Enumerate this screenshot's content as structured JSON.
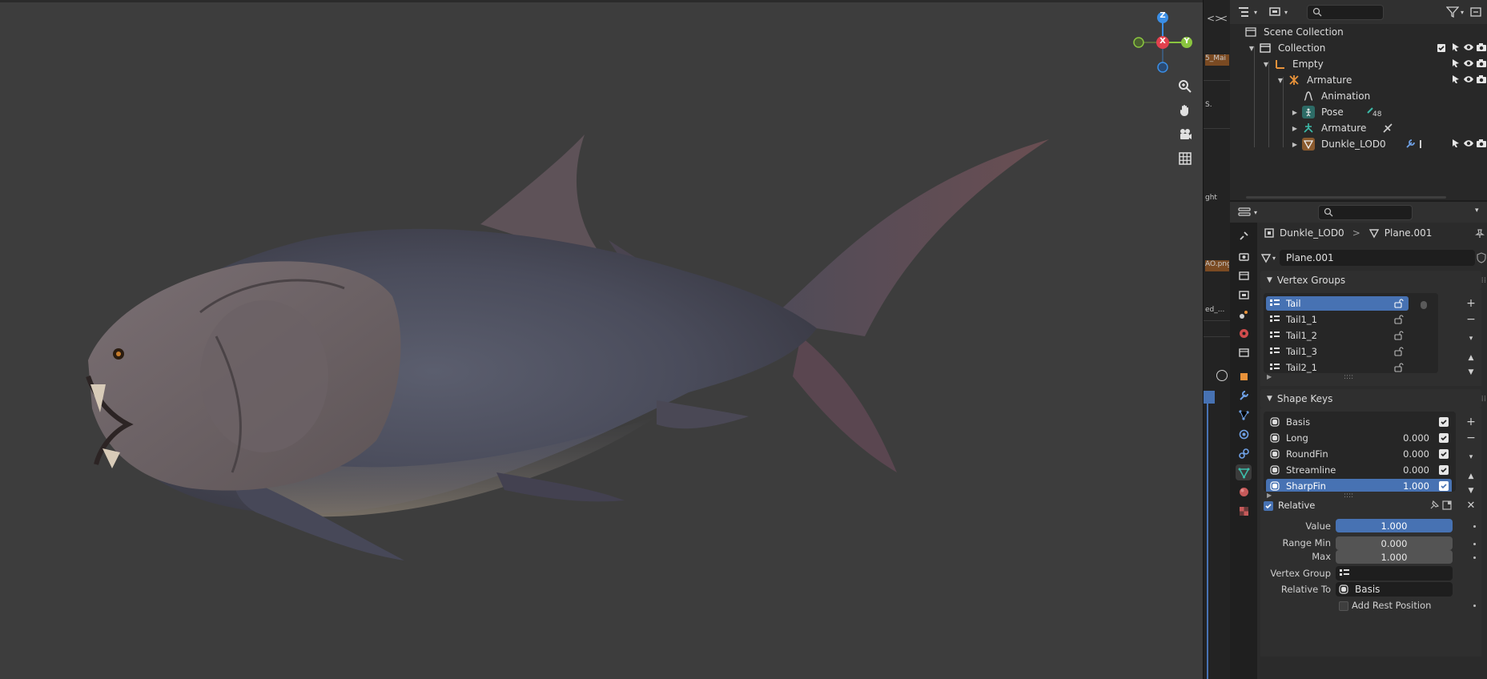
{
  "outliner": {
    "search_placeholder": "",
    "rows": [
      {
        "label": "Scene Collection"
      },
      {
        "label": "Collection"
      },
      {
        "label": "Empty"
      },
      {
        "label": "Armature"
      },
      {
        "label": "Animation"
      },
      {
        "label": "Pose",
        "badge": "48"
      },
      {
        "label": "Armature"
      },
      {
        "label": "Dunkle_LOD0"
      }
    ]
  },
  "middle_strip": {
    "chips": [
      "5_Mai",
      "S.",
      "ght",
      "AO.png",
      "ed_..."
    ]
  },
  "properties": {
    "breadcrumb": {
      "object": "Dunkle_LOD0",
      "separator": ">",
      "mesh": "Plane.001"
    },
    "data_name": "Plane.001",
    "vertex_groups": {
      "title": "Vertex Groups",
      "items": [
        {
          "label": "Tail",
          "selected": true
        },
        {
          "label": "Tail1_1",
          "selected": false
        },
        {
          "label": "Tail1_2",
          "selected": false
        },
        {
          "label": "Tail1_3",
          "selected": false
        },
        {
          "label": "Tail2_1",
          "selected": false
        }
      ]
    },
    "shape_keys": {
      "title": "Shape Keys",
      "items": [
        {
          "label": "Basis",
          "value": "",
          "selected": false
        },
        {
          "label": "Long",
          "value": "0.000",
          "selected": false
        },
        {
          "label": "RoundFin",
          "value": "0.000",
          "selected": false
        },
        {
          "label": "Streamline",
          "value": "0.000",
          "selected": false
        },
        {
          "label": "SharpFin",
          "value": "1.000",
          "selected": true
        }
      ]
    },
    "relative_label": "Relative",
    "value_label": "Value",
    "value": "1.000",
    "range_min_label": "Range Min",
    "range_min": "0.000",
    "max_label": "Max",
    "max": "1.000",
    "vertex_group_label": "Vertex Group",
    "vertex_group_value": "",
    "relative_to_label": "Relative To",
    "relative_to_value": "Basis",
    "add_rest_label": "Add Rest Position"
  },
  "gizmo": {
    "x": "X",
    "y": "Y",
    "z": "Z"
  },
  "colors": {
    "accent": "#4772b3",
    "viewport_bg": "#3d3d3d",
    "gizmo_x": "#e2414e",
    "gizmo_y": "#8ac53f",
    "gizmo_z": "#3a8ee6"
  }
}
